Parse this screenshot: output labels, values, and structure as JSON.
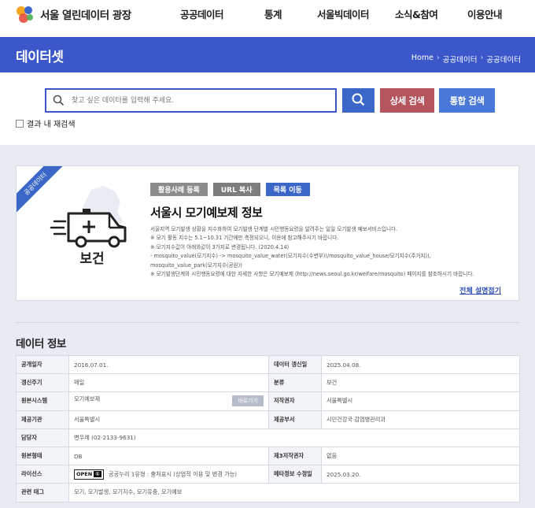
{
  "header": {
    "site_title": "서울 열린데이터 광장",
    "nav": [
      "공공데이터",
      "통계",
      "서울빅데이터",
      "소식&참여",
      "이용안내"
    ]
  },
  "band": {
    "title": "데이터셋",
    "breadcrumb": [
      "Home",
      "공공데이터",
      "공공데이터"
    ]
  },
  "search": {
    "placeholder": "찾고 싶은 데이터를 입력해 주세요.",
    "search_icon": "search-icon",
    "detail_label": "상세 검색",
    "total_label": "통합 검색",
    "recheck_label": "결과 내 재검색"
  },
  "dataset": {
    "ribbon": "공공데이터",
    "category": "보건",
    "category_icon": "ambulance-icon",
    "buttons": {
      "usecase": "활용사례 등록",
      "url_copy": "URL 복사",
      "list": "목록 이동"
    },
    "title": "서울시 모기예보제 정보",
    "description": [
      "서울지역 모기발생 상황을 지수화하여 모기발생 단계별 시민행동요령을 알려주는 일일 모기발생 예보서비스입니다.",
      "※ 모기 활동 지수는 5.1~10.31 기간에만 측정되오니, 이용에 참고해주시기 바랍니다.",
      "※ 모기지수값이 아래와같이 3가지로 변경됩니다. (2020.4.14)",
      "- mosquito_value(모기지수) -> mosquito_value_water(모기지수(수변부))/mosquito_value_house/모기지수(주거지)),",
      "mosquito_value_park(모기지수(공원))",
      "※ 모기발생단계와 시민행동요령에 대한 자세한 사항은 모기예보제 (http://news.seoul.go.kr/welfare/mosquito) 페이지를 참조하시기 바랍니다."
    ],
    "fold_label": "전체 설명접기"
  },
  "info": {
    "title": "데이터 정보",
    "rows": [
      {
        "k1": "공개일자",
        "v1": "2016.07.01.",
        "k2": "데이터 갱신일",
        "v2": "2025.04.08."
      },
      {
        "k1": "갱신주기",
        "v1": "매일",
        "k2": "분류",
        "v2": "보건"
      },
      {
        "k1": "원본시스템",
        "v1": "모기예보제",
        "k2": "저작권자",
        "v2": "서울특별시"
      },
      {
        "k1": "제공기관",
        "v1": "서울특별시",
        "k2": "제공부서",
        "v2": "시민건강국 감염병관리과"
      },
      {
        "k1": "담당자",
        "v1": "변우례 (02-2133-9631)"
      },
      {
        "k1": "원본형태",
        "v1": "DB",
        "k2": "제3저작권자",
        "v2": "없음"
      },
      {
        "k1": "라이선스",
        "v1": "공공누리 1유형 : 출처표시 (상업적 이용 및 변경 가능)",
        "k2": "메타정보 수정일",
        "v2": "2025.03.20."
      },
      {
        "k1": "관련 태그",
        "v1": "모기, 모기발생, 모기지수, 모기유충, 모기예보"
      }
    ],
    "orig_button": "바로가기",
    "license_badge": "OPEN",
    "license_badge_mark": "①"
  }
}
